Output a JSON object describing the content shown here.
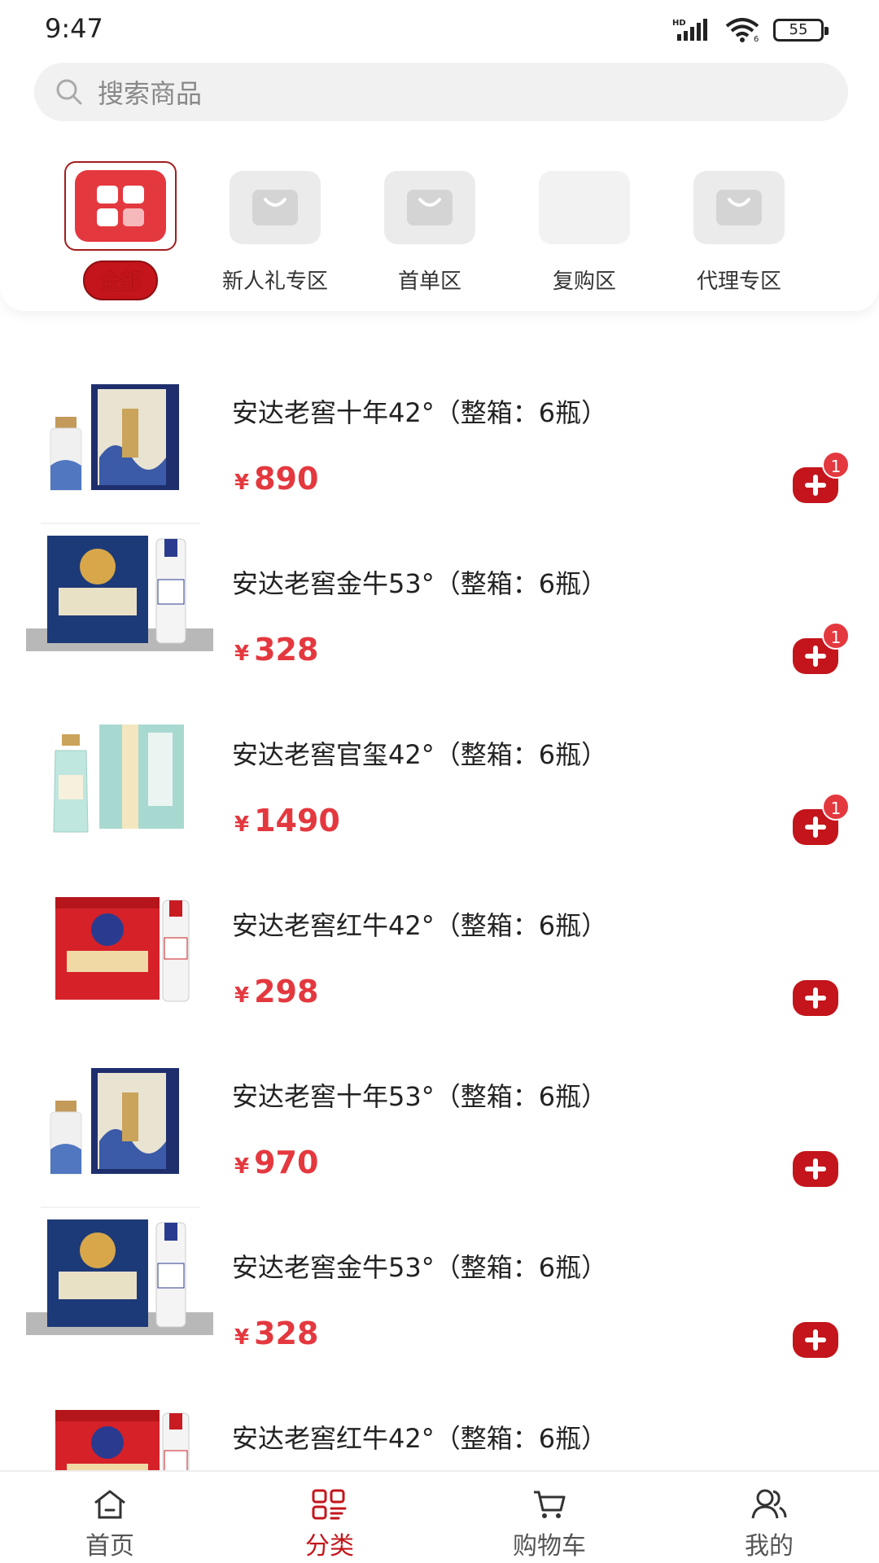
{
  "status_bar": {
    "time": "9:47",
    "battery": "55",
    "network": "HD"
  },
  "search": {
    "placeholder": "搜索商品"
  },
  "categories": [
    {
      "label": "全部",
      "active": true
    },
    {
      "label": "新人礼专区",
      "active": false
    },
    {
      "label": "首单区",
      "active": false
    },
    {
      "label": "复购区",
      "active": false
    },
    {
      "label": "代理专区",
      "active": false
    }
  ],
  "products": [
    {
      "title": "安达老窖十年42°（整箱：6瓶）",
      "currency": "¥",
      "price": "890",
      "badge": "1",
      "image": "navy-dragon-box"
    },
    {
      "title": "安达老窖金牛53°（整箱：6瓶）",
      "currency": "¥",
      "price": "328",
      "badge": "1",
      "image": "blue-bull-box"
    },
    {
      "title": "安达老窖官玺42°（整箱：6瓶）",
      "currency": "¥",
      "price": "1490",
      "badge": "1",
      "image": "mint-gold-box"
    },
    {
      "title": "安达老窖红牛42°（整箱：6瓶）",
      "currency": "¥",
      "price": "298",
      "badge": "",
      "image": "red-bull-box"
    },
    {
      "title": "安达老窖十年53°（整箱：6瓶）",
      "currency": "¥",
      "price": "970",
      "badge": "",
      "image": "navy-dragon-box"
    },
    {
      "title": "安达老窖金牛53°（整箱：6瓶）",
      "currency": "¥",
      "price": "328",
      "badge": "",
      "image": "blue-bull-box"
    },
    {
      "title": "安达老窖红牛42°（整箱：6瓶）",
      "currency": "",
      "price": "",
      "badge": "",
      "image": "red-bull-box"
    }
  ],
  "tabbar": [
    {
      "label": "首页",
      "icon": "home-icon",
      "active": false
    },
    {
      "label": "分类",
      "icon": "category-icon",
      "active": true
    },
    {
      "label": "购物车",
      "icon": "cart-icon",
      "active": false
    },
    {
      "label": "我的",
      "icon": "user-icon",
      "active": false
    }
  ],
  "colors": {
    "accent": "#c3151b",
    "price": "#e4383f",
    "badge": "#e4383f"
  }
}
